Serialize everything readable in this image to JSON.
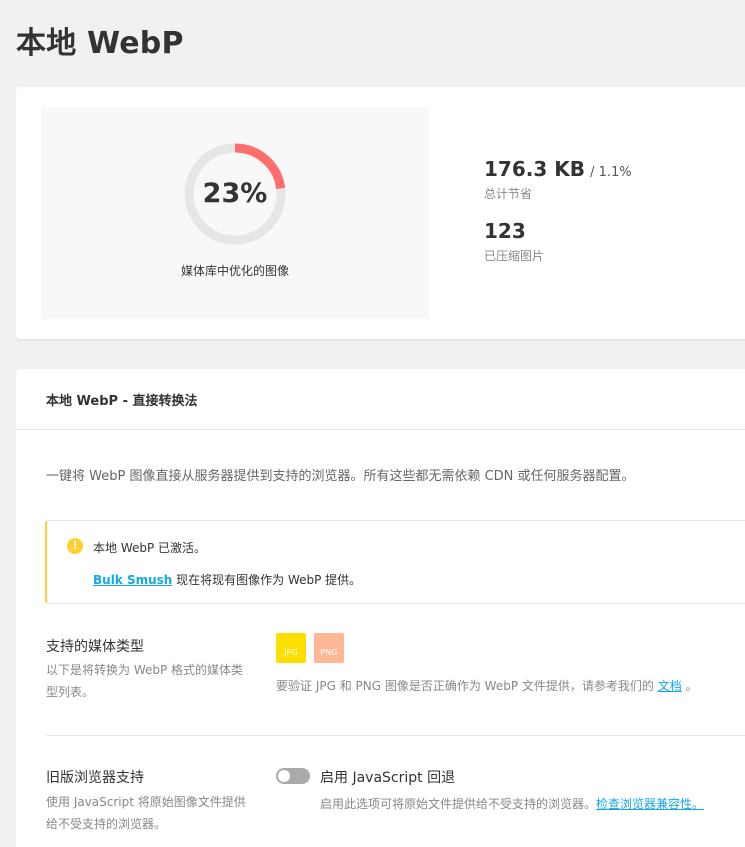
{
  "page": {
    "title": "本地 WebP"
  },
  "summary": {
    "percent_label": "23%",
    "percent_value": 23,
    "caption": "媒体库中优化的图像",
    "savings_value": "176.3 KB",
    "savings_suffix": "/ 1.1%",
    "savings_label": "总计节省",
    "compressed_value": "123",
    "compressed_label": "已压缩图片",
    "colors": {
      "progress": "#ff6d6d",
      "track": "#e6e6e6"
    }
  },
  "section": {
    "title": "本地 WebP - 直接转换法",
    "intro": "一键将 WebP 图像直接从服务器提供到支持的浏览器。所有这些都无需依赖 CDN 或任何服务器配置。",
    "notice": {
      "line1": "本地 WebP 已激活。",
      "line2_link": "Bulk Smush",
      "line2_text": " 现在将现有图像作为 WebP 提供。"
    },
    "media_types": {
      "label": "支持的媒体类型",
      "desc": "以下是将转换为 WebP 格式的媒体类型列表。",
      "badge_jpg": "JPG",
      "badge_png": "PNG",
      "help_text": "要验证 JPG 和 PNG 图像是否正确作为 WebP 文件提供，请参考我们的 ",
      "help_link": "文档",
      "help_end": " 。"
    },
    "legacy": {
      "label": "旧版浏览器支持",
      "desc": "使用 JavaScript 将原始图像文件提供给不受支持的浏览器。",
      "toggle_label": "启用 JavaScript 回退",
      "help_text": "启用此选项可将原始文件提供给不受支持的浏览器。",
      "help_link": "检查浏览器兼容性。"
    }
  }
}
